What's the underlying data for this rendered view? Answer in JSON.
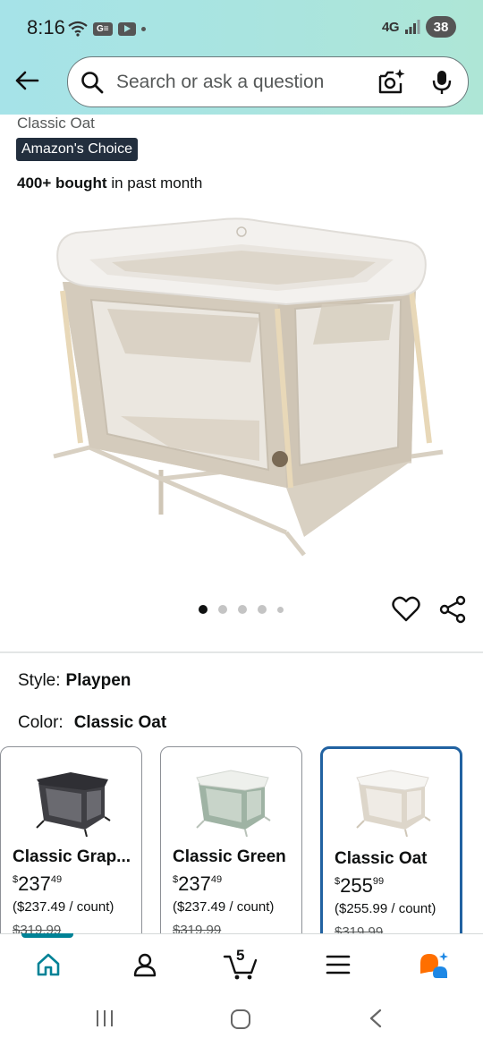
{
  "status_bar": {
    "time": "8:16",
    "network": "4G",
    "battery": "38",
    "icons": [
      "wifi-icon",
      "app-notification-icon",
      "youtube-icon",
      "dot-icon",
      "signal-icon",
      "battery-icon"
    ]
  },
  "search": {
    "placeholder": "Search or ask a question",
    "icons": [
      "back-arrow-icon",
      "search-icon",
      "camera-icon",
      "microphone-icon"
    ]
  },
  "product": {
    "variant_name": "Classic Oat",
    "badge": "Amazon's Choice",
    "bought_bold": "400+ bought",
    "bought_rest": " in past month",
    "image_count": 5,
    "active_image": 1
  },
  "options": {
    "style_label": "Style:",
    "style_value": "Playpen",
    "color_label": "Color:",
    "color_value": "Classic Oat"
  },
  "variants": [
    {
      "name": "Classic Grap...",
      "currency": "$",
      "price_whole": "237",
      "price_fraction": "49",
      "unit_price": "($237.49 / count)",
      "list_price": "$319.99",
      "selected": false,
      "swatch": "#3f3f44"
    },
    {
      "name": "Classic Green",
      "currency": "$",
      "price_whole": "237",
      "price_fraction": "49",
      "unit_price": "($237.49 / count)",
      "list_price": "$319.99",
      "selected": false,
      "swatch": "#9fb3a4"
    },
    {
      "name": "Classic Oat",
      "currency": "$",
      "price_whole": "255",
      "price_fraction": "99",
      "unit_price": "($255.99 / count)",
      "list_price": "$319.99",
      "selected": true,
      "swatch": "#ddd6ca"
    }
  ],
  "tabbar": {
    "cart_count": "5",
    "tabs": [
      "home-icon",
      "account-icon",
      "cart-icon",
      "menu-icon",
      "rufus-icon"
    ]
  },
  "colors": {
    "header_gradient_start": "#a6e3e8",
    "header_gradient_end": "#aee6d6",
    "badge_bg": "#232f3e",
    "selected_border": "#2162a1",
    "home_indicator": "#008296",
    "rufus_orange": "#ff6f00",
    "rufus_blue": "#1e88e5"
  }
}
